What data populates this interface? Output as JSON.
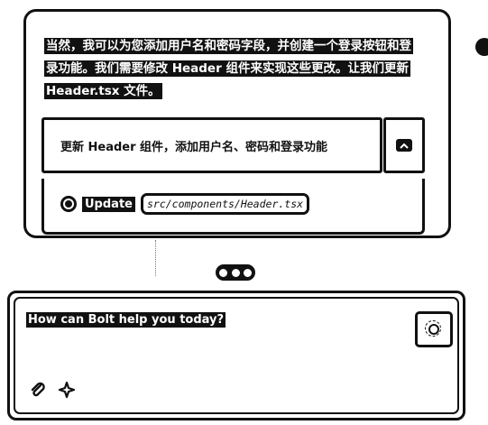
{
  "chat_message": {
    "text": "当然，我可以为您添加用户名和密码字段，并创建一个登录按钮和登录功能。我们需要修改 Header 组件来实现这些更改。让我们更新 Header.tsx 文件。"
  },
  "artifact": {
    "title": "更新 Header 组件，添加用户名、密码和登录功能",
    "collapse_icon": "chevron-up-icon",
    "action": {
      "status_icon": "circle-loading-icon",
      "label": "Update",
      "path": "src/components/Header.tsx"
    }
  },
  "loading_indicator": {
    "icon": "three-dots-icon"
  },
  "chat_input": {
    "placeholder": "How can Bolt help you today?",
    "enhance_icon": "enhance-prompt-icon",
    "attach_icon": "paperclip-icon",
    "magic_icon": "sparkle-icon"
  }
}
